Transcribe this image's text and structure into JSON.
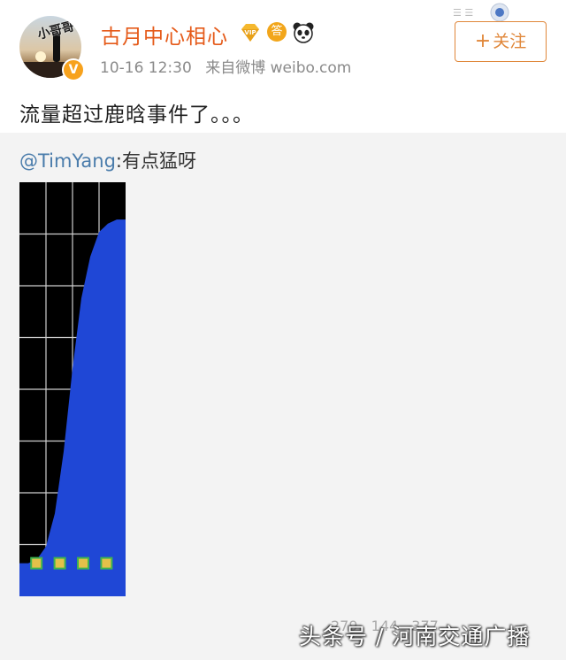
{
  "post": {
    "avatar_tag": "小哥哥",
    "verified_mark": "V",
    "username": "古月中心相心",
    "answer_badge": "答",
    "time": "10-16 12:30",
    "source": "来自微博 weibo.com",
    "follow_label": "关注",
    "follow_icon": "plus-icon",
    "text": "流量超过鹿晗事件了。。。",
    "icons": [
      "vip-diamond-icon",
      "answer-badge-icon",
      "panda-icon"
    ]
  },
  "repost": {
    "mention": "@TimYang",
    "text": ":有点猛呀"
  },
  "chart_data": {
    "type": "area",
    "x": [
      0,
      1,
      2,
      3,
      4,
      5,
      6,
      7,
      8,
      9,
      10,
      11,
      12
    ],
    "values": [
      8,
      8,
      9,
      12,
      20,
      35,
      55,
      72,
      82,
      88,
      90,
      91,
      91
    ],
    "ylim": [
      0,
      100
    ],
    "grid": true,
    "colors": {
      "fill": "#1f47d6",
      "background": "#000000",
      "grid": "#cfcfcf"
    }
  },
  "stats": {
    "repost": "279",
    "comment": "144",
    "like": "377"
  },
  "watermark": "头条号 / 河南交通广播"
}
